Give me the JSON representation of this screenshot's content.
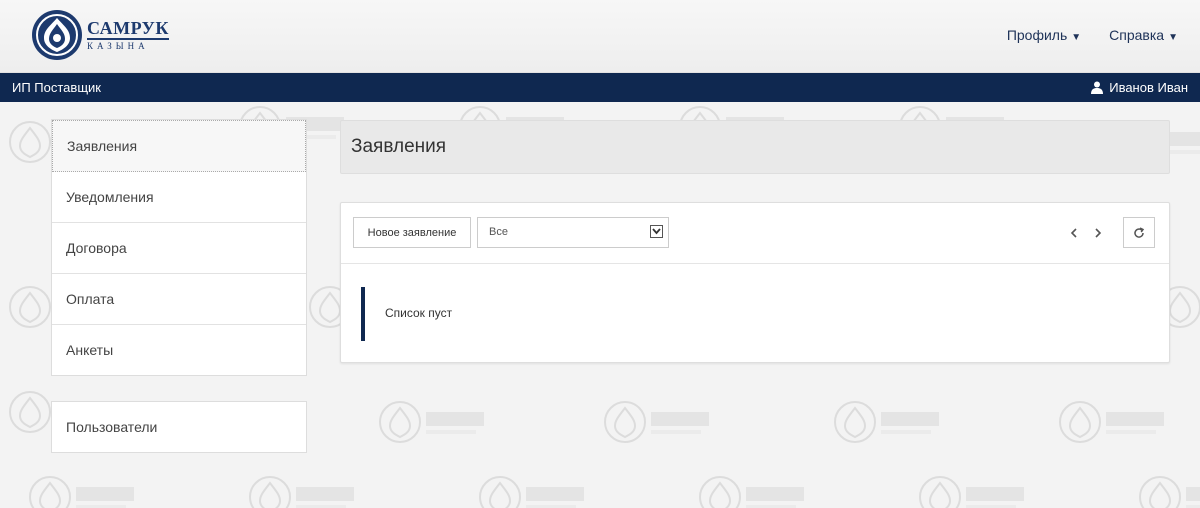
{
  "brand": {
    "name": "САМРУК",
    "subtitle": "КАЗЫНА"
  },
  "top_menu": [
    {
      "label": "Профиль"
    },
    {
      "label": "Справка"
    }
  ],
  "navbar": {
    "title": "ИП Поставщик",
    "user": "Иванов Иван"
  },
  "sidebar": {
    "items": [
      {
        "label": "Заявления",
        "active": true
      },
      {
        "label": "Уведомления"
      },
      {
        "label": "Договора"
      },
      {
        "label": "Оплата"
      },
      {
        "label": "Анкеты"
      }
    ],
    "secondary": [
      {
        "label": "Пользователи"
      }
    ]
  },
  "page": {
    "title": "Заявления"
  },
  "toolbar": {
    "new_label": "Новое заявление",
    "filter_value": "Все"
  },
  "list": {
    "empty_text": "Список пуст"
  },
  "colors": {
    "navbar": "#0f2850",
    "accent": "#1d3a6e"
  }
}
